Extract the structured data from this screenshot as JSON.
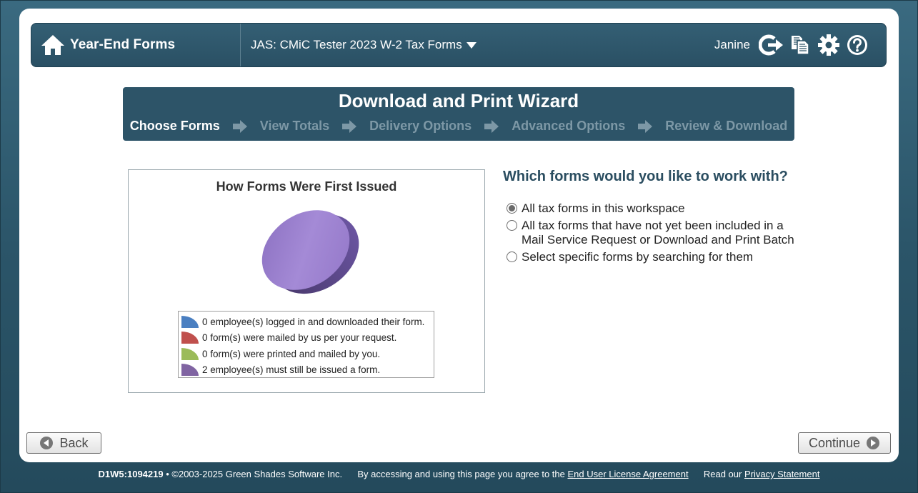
{
  "header": {
    "app_title": "Year-End Forms",
    "workspace_label": "JAS: CMiC Tester 2023 W-2 Tax Forms",
    "username": "Janine"
  },
  "wizard": {
    "title": "Download and Print Wizard",
    "steps": [
      "Choose Forms",
      "View Totals",
      "Delivery Options",
      "Advanced Options",
      "Review & Download"
    ],
    "active_step": 0
  },
  "chart_data": {
    "type": "pie",
    "title": "How Forms Were First Issued",
    "categories": [
      "0 employee(s) logged in and downloaded their form.",
      "0 form(s) were mailed by us per your request.",
      "0 form(s) were printed and mailed by you.",
      "2 employee(s) must still be issued a form."
    ],
    "values": [
      0,
      0,
      0,
      2
    ],
    "colors": [
      "#4a7fc1",
      "#c0504d",
      "#9bbb59",
      "#8064a2"
    ]
  },
  "question": {
    "prompt": "Which forms would you like to work with?",
    "options": [
      {
        "line1": "All tax forms in this workspace",
        "line2": "",
        "checked": true
      },
      {
        "line1": "All tax forms that have not yet been included in a",
        "line2": "Mail Service Request or Download and Print Batch",
        "checked": false
      },
      {
        "line1": "Select specific forms by searching for them",
        "line2": "",
        "checked": false
      }
    ]
  },
  "buttons": {
    "back": "Back",
    "continue": "Continue"
  },
  "footer": {
    "code": "D1W5:1094219",
    "copyright": "• ©2003-2025 Green Shades Software Inc.",
    "agree_text": "By accessing and using this page you agree to the",
    "eula_link": "End User License Agreement",
    "read_text": "Read our",
    "privacy_link": "Privacy Statement"
  }
}
